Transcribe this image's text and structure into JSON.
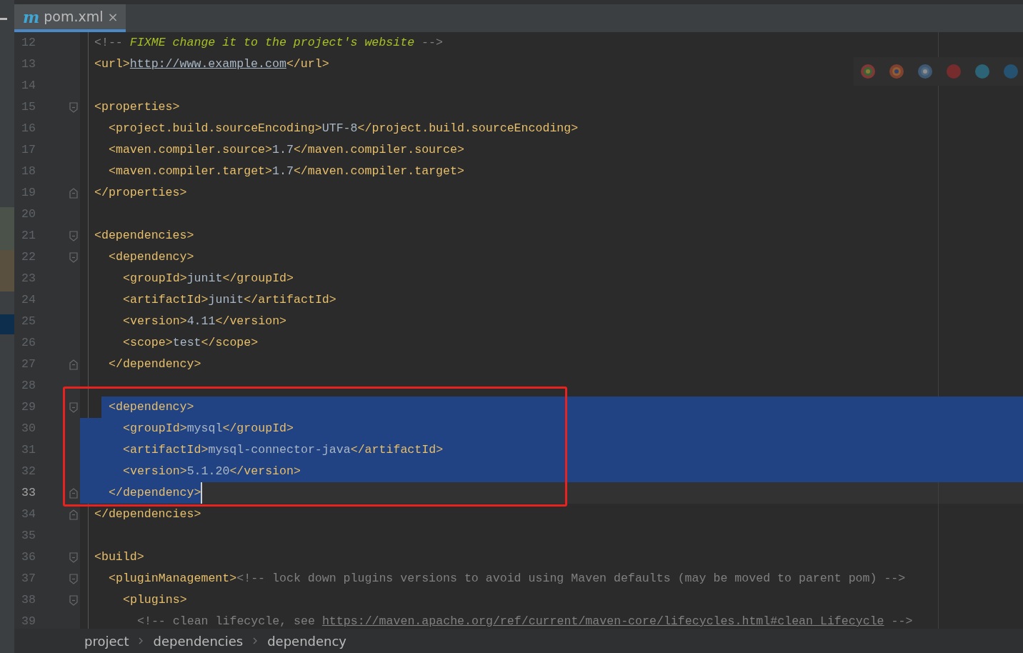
{
  "tab": {
    "icon": "m",
    "label": "pom.xml",
    "close": "×",
    "selected": true
  },
  "lines": [
    {
      "number": "12",
      "fold_start": false,
      "fold_end": false,
      "selected": false,
      "caret": false,
      "tokens": [
        {
          "kind": "comment",
          "text": "<!-- "
        },
        {
          "kind": "todo",
          "text": "FIXME change it to the project's website"
        },
        {
          "kind": "comment",
          "text": " -->"
        }
      ]
    },
    {
      "number": "13",
      "fold_start": false,
      "fold_end": false,
      "selected": false,
      "caret": false,
      "tokens": [
        {
          "kind": "tag",
          "text": "<url>"
        },
        {
          "kind": "link",
          "text": "http://www.example.com"
        },
        {
          "kind": "tag",
          "text": "</url>"
        }
      ]
    },
    {
      "number": "14",
      "fold_start": false,
      "fold_end": false,
      "selected": false,
      "caret": false
    },
    {
      "number": "15",
      "fold_start": true,
      "fold_end": false,
      "selected": false,
      "caret": false,
      "tokens": [
        {
          "kind": "tag",
          "text": "<properties>"
        }
      ],
      "children": [
        {
          "number": "16",
          "fold_start": false,
          "fold_end": false,
          "selected": false,
          "caret": false,
          "tokens": [
            {
              "kind": "tag",
              "text": "<project.build.sourceEncoding>"
            },
            {
              "kind": "text",
              "text": "UTF-8"
            },
            {
              "kind": "tag",
              "text": "</project.build.sourceEncoding>"
            }
          ]
        },
        {
          "number": "17",
          "fold_start": false,
          "fold_end": false,
          "selected": false,
          "caret": false,
          "tokens": [
            {
              "kind": "tag",
              "text": "<maven.compiler.source>"
            },
            {
              "kind": "text",
              "text": "1.7"
            },
            {
              "kind": "tag",
              "text": "</maven.compiler.source>"
            }
          ]
        },
        {
          "number": "18",
          "fold_start": false,
          "fold_end": false,
          "selected": false,
          "caret": false,
          "tokens": [
            {
              "kind": "tag",
              "text": "<maven.compiler.target>"
            },
            {
              "kind": "text",
              "text": "1.7"
            },
            {
              "kind": "tag",
              "text": "</maven.compiler.target>"
            }
          ]
        }
      ]
    },
    {
      "number": "19",
      "fold_start": false,
      "fold_end": true,
      "selected": false,
      "caret": false,
      "tokens": [
        {
          "kind": "tag",
          "text": "</properties>"
        }
      ]
    },
    {
      "number": "20",
      "fold_start": false,
      "fold_end": false,
      "selected": false,
      "caret": false
    },
    {
      "number": "21",
      "fold_start": true,
      "fold_end": false,
      "selected": false,
      "caret": false,
      "tokens": [
        {
          "kind": "tag",
          "text": "<dependencies>"
        }
      ],
      "children": [
        {
          "number": "22",
          "fold_start": true,
          "fold_end": false,
          "selected": false,
          "caret": false,
          "tokens": [
            {
              "kind": "tag",
              "text": "<dependency>"
            }
          ],
          "children": [
            {
              "number": "23",
              "fold_start": false,
              "fold_end": false,
              "selected": false,
              "caret": false,
              "tokens": [
                {
                  "kind": "tag",
                  "text": "<groupId>"
                },
                {
                  "kind": "text",
                  "text": "junit"
                },
                {
                  "kind": "tag",
                  "text": "</groupId>"
                }
              ]
            },
            {
              "number": "24",
              "fold_start": false,
              "fold_end": false,
              "selected": false,
              "caret": false,
              "tokens": [
                {
                  "kind": "tag",
                  "text": "<artifactId>"
                },
                {
                  "kind": "text",
                  "text": "junit"
                },
                {
                  "kind": "tag",
                  "text": "</artifactId>"
                }
              ]
            },
            {
              "number": "25",
              "fold_start": false,
              "fold_end": false,
              "selected": false,
              "caret": false,
              "tokens": [
                {
                  "kind": "tag",
                  "text": "<version>"
                },
                {
                  "kind": "text",
                  "text": "4.11"
                },
                {
                  "kind": "tag",
                  "text": "</version>"
                }
              ]
            },
            {
              "number": "26",
              "fold_start": false,
              "fold_end": false,
              "selected": false,
              "caret": false,
              "tokens": [
                {
                  "kind": "tag",
                  "text": "<scope>"
                },
                {
                  "kind": "text",
                  "text": "test"
                },
                {
                  "kind": "tag",
                  "text": "</scope>"
                }
              ]
            }
          ]
        },
        {
          "number": "27",
          "fold_start": false,
          "fold_end": true,
          "selected": false,
          "caret": false,
          "tokens": [
            {
              "kind": "tag",
              "text": "</dependency>"
            }
          ]
        },
        {
          "number": "28",
          "fold_start": false,
          "fold_end": false,
          "selected": false,
          "caret": false
        },
        {
          "number": "29",
          "fold_start": true,
          "fold_end": false,
          "selected": true,
          "caret": false,
          "tokens": [
            {
              "kind": "tag",
              "text": "<dependency>"
            }
          ],
          "children": [
            {
              "number": "30",
              "fold_start": false,
              "fold_end": false,
              "selected": true,
              "caret": false,
              "tokens": [
                {
                  "kind": "tag",
                  "text": "<groupId>"
                },
                {
                  "kind": "text",
                  "text": "mysql"
                },
                {
                  "kind": "tag",
                  "text": "</groupId>"
                }
              ]
            },
            {
              "number": "31",
              "fold_start": false,
              "fold_end": false,
              "selected": true,
              "caret": false,
              "tokens": [
                {
                  "kind": "tag",
                  "text": "<artifactId>"
                },
                {
                  "kind": "text",
                  "text": "mysql-connector-java"
                },
                {
                  "kind": "tag",
                  "text": "</artifactId>"
                }
              ]
            },
            {
              "number": "32",
              "fold_start": false,
              "fold_end": false,
              "selected": true,
              "caret": false,
              "tokens": [
                {
                  "kind": "tag",
                  "text": "<version>"
                },
                {
                  "kind": "text",
                  "text": "5.1.20"
                },
                {
                  "kind": "tag",
                  "text": "</version>"
                }
              ]
            }
          ]
        },
        {
          "number": "33",
          "fold_start": false,
          "fold_end": true,
          "selected": true,
          "caret": true,
          "tokens": [
            {
              "kind": "tag",
              "text": "</dependency>"
            }
          ]
        }
      ]
    },
    {
      "number": "34",
      "fold_start": false,
      "fold_end": true,
      "selected": false,
      "caret": false,
      "tokens": [
        {
          "kind": "tag",
          "text": "</dependencies>"
        }
      ]
    },
    {
      "number": "35",
      "fold_start": false,
      "fold_end": false,
      "selected": false,
      "caret": false
    },
    {
      "number": "36",
      "fold_start": true,
      "fold_end": false,
      "selected": false,
      "caret": false,
      "tokens": [
        {
          "kind": "tag",
          "text": "<build>"
        }
      ],
      "children": [
        {
          "number": "37",
          "fold_start": true,
          "fold_end": false,
          "selected": false,
          "caret": false,
          "tokens": [
            {
              "kind": "tag",
              "text": "<pluginManagement>"
            },
            {
              "kind": "comment",
              "text": "<!-- lock down plugins versions to avoid using Maven defaults (may be moved to parent pom) -->"
            }
          ],
          "children": [
            {
              "number": "38",
              "fold_start": true,
              "fold_end": false,
              "selected": false,
              "caret": false,
              "tokens": [
                {
                  "kind": "tag",
                  "text": "<plugins>"
                }
              ],
              "children": [
                {
                  "number": "39",
                  "fold_start": false,
                  "fold_end": false,
                  "selected": false,
                  "caret": false,
                  "tokens": [
                    {
                      "kind": "comment",
                      "text": "<!-- clean lifecycle, see "
                    },
                    {
                      "kind": "comment_link",
                      "text": "https://maven.apache.org/ref/current/maven-core/lifecycles.html#clean_Lifecycle"
                    },
                    {
                      "kind": "comment",
                      "text": " -->"
                    }
                  ]
                }
              ]
            }
          ]
        }
      ]
    }
  ],
  "annotation": {
    "kind": "rectangle",
    "color": "#e8231f"
  },
  "breadcrumbs": [
    {
      "label": "project"
    },
    {
      "label": "dependencies"
    },
    {
      "label": "dependency"
    }
  ]
}
